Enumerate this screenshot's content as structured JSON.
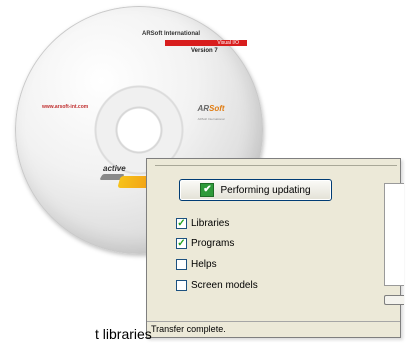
{
  "cd": {
    "title": "ARSoft International",
    "product": "Visual I/O",
    "version": "Version 7",
    "url": "www.arsoft-int.com",
    "logo_main": "AR",
    "logo_accent": "Soft",
    "logo_sub": "ARSoft International",
    "active_text": "active"
  },
  "dialog": {
    "perform_button_label": "Performing updating",
    "perform_icon": "check-icon",
    "options": [
      {
        "label": "Libraries",
        "checked": true
      },
      {
        "label": "Programs",
        "checked": true
      },
      {
        "label": "Helps",
        "checked": false
      },
      {
        "label": "Screen models",
        "checked": false
      }
    ],
    "status_text": "Transfer complete."
  },
  "caption": {
    "text": "t libraries"
  },
  "colors": {
    "dialog_bg": "#ece9d8",
    "check_color": "#21a121",
    "cd_red": "#d81e1e",
    "swoosh_orange": "#f08a12"
  }
}
